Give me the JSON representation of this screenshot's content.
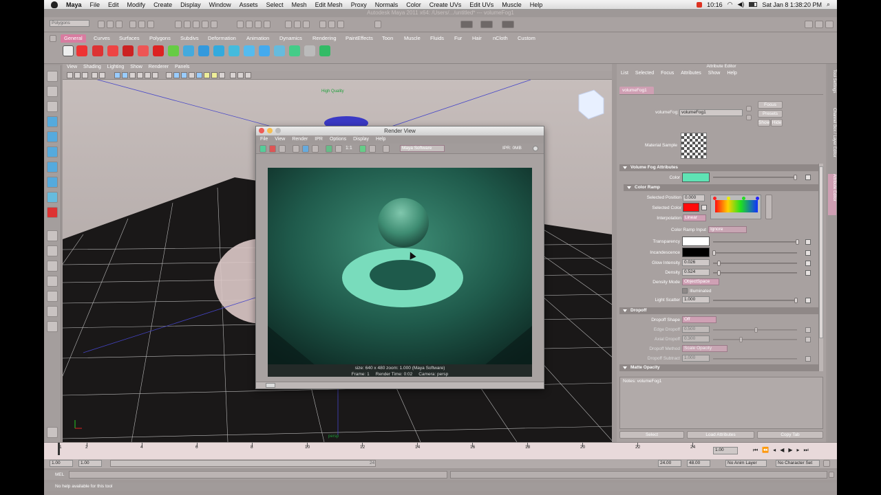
{
  "menubar": {
    "app": "Maya",
    "items": [
      "File",
      "Edit",
      "Modify",
      "Create",
      "Display",
      "Window",
      "Assets",
      "Select",
      "Mesh",
      "Edit Mesh",
      "Proxy",
      "Normals",
      "Color",
      "Create UVs",
      "Edit UVs",
      "Muscle",
      "Help"
    ],
    "clock": "10:16",
    "datetime": "Sat Jan 8  1:38:20 PM"
  },
  "window_title": "Autodesk Maya 2011 x64: /Users/.../untitled* --- volumeFog1",
  "status_line": {
    "menu_set": "Polygons"
  },
  "shelf": {
    "tabs": [
      "General",
      "Curves",
      "Surfaces",
      "Polygons",
      "Subdivs",
      "Deformation",
      "Animation",
      "Dynamics",
      "Rendering",
      "PaintEffects",
      "Toon",
      "Muscle",
      "Fluids",
      "Fur",
      "Hair",
      "nCloth",
      "Custom"
    ],
    "active_tab": "General"
  },
  "viewport": {
    "menu": [
      "View",
      "Shading",
      "Lighting",
      "Show",
      "Renderer",
      "Panels"
    ],
    "hud_quality": "High Quality",
    "camera": "persp"
  },
  "render_view": {
    "title": "Render View",
    "menu": [
      "File",
      "View",
      "Render",
      "IPR",
      "Options",
      "Display",
      "Help"
    ],
    "ratio_label": "1:1",
    "renderer": "Maya Software",
    "ipr_label": "IPR: 0MB",
    "status_line1": "size: 640 x 480  zoom: 1.000      (Maya Software)",
    "status_frame": "Frame: 1",
    "status_time": "Render Time: 0:02",
    "status_camera": "Camera: persp"
  },
  "attribute_editor": {
    "title": "Attribute Editor",
    "menu": [
      "List",
      "Selected",
      "Focus",
      "Attributes",
      "Show",
      "Help"
    ],
    "node_tab": "volumeFog1",
    "node_label": "volumeFog:",
    "node_name": "volumeFog1",
    "buttons": {
      "focus": "Focus",
      "presets": "Presets",
      "show": "Show",
      "hide": "Hide"
    },
    "material_sample": "Material Sample",
    "sections": {
      "volume_fog": "Volume Fog Attributes",
      "color_ramp": "Color Ramp",
      "dropoff": "Dropoff",
      "matte": "Matte Opacity"
    },
    "attrs": {
      "color": "Color",
      "selected_position_label": "Selected Position",
      "selected_position": "0.000",
      "selected_color_label": "Selected Color",
      "interpolation_label": "Interpolation",
      "interpolation": "Linear",
      "color_ramp_input_label": "Color Ramp Input",
      "color_ramp_input": "Ignore",
      "transparency": "Transparency",
      "incandescence": "Incandescence",
      "glow_intensity_label": "Glow Intensity",
      "glow_intensity": "0.026",
      "density_label": "Density",
      "density": "0.524",
      "density_mode_label": "Density Mode",
      "density_mode": "ObjectSpace",
      "illuminated": "Illuminated",
      "light_scatter_label": "Light Scatter",
      "light_scatter": "1.000",
      "dropoff_shape_label": "Dropoff Shape",
      "dropoff_shape": "Off",
      "edge_dropoff_label": "Edge Dropoff",
      "edge_dropoff": "0.500",
      "axial_dropoff_label": "Axial Dropoff",
      "axial_dropoff": "0.300",
      "dropoff_method_label": "Dropoff Method",
      "dropoff_method": "Scale Opacity",
      "dropoff_subtract_label": "Dropoff Subtract",
      "dropoff_subtract": "1.000"
    },
    "notes": "Notes:  volumeFog1",
    "bottom_buttons": [
      "Select",
      "Load Attributes",
      "Copy Tab"
    ],
    "side_tabs": [
      "Tool Settings",
      "Channel Box / Layer Editor",
      "Attribute Editor"
    ]
  },
  "colors": {
    "fog_color": "#5fe3b4",
    "selected_color": "#ff0a0a",
    "transparency": "#ffffff",
    "incandescence": "#000000",
    "active_tab": "#d87ca0"
  },
  "timeline": {
    "ticks": [
      "1",
      "2",
      "4",
      "6",
      "8",
      "10",
      "12",
      "14",
      "16",
      "18",
      "20",
      "22",
      "24"
    ],
    "current": "1.00"
  },
  "range": {
    "start": "1.00",
    "inner_start": "1.00",
    "range_end_label": "24",
    "end": "24.00",
    "max": "48.00",
    "anim_layer": "No Anim Layer",
    "character": "No Character Set"
  },
  "mel": "MEL",
  "help_line": "No help available for this tool"
}
